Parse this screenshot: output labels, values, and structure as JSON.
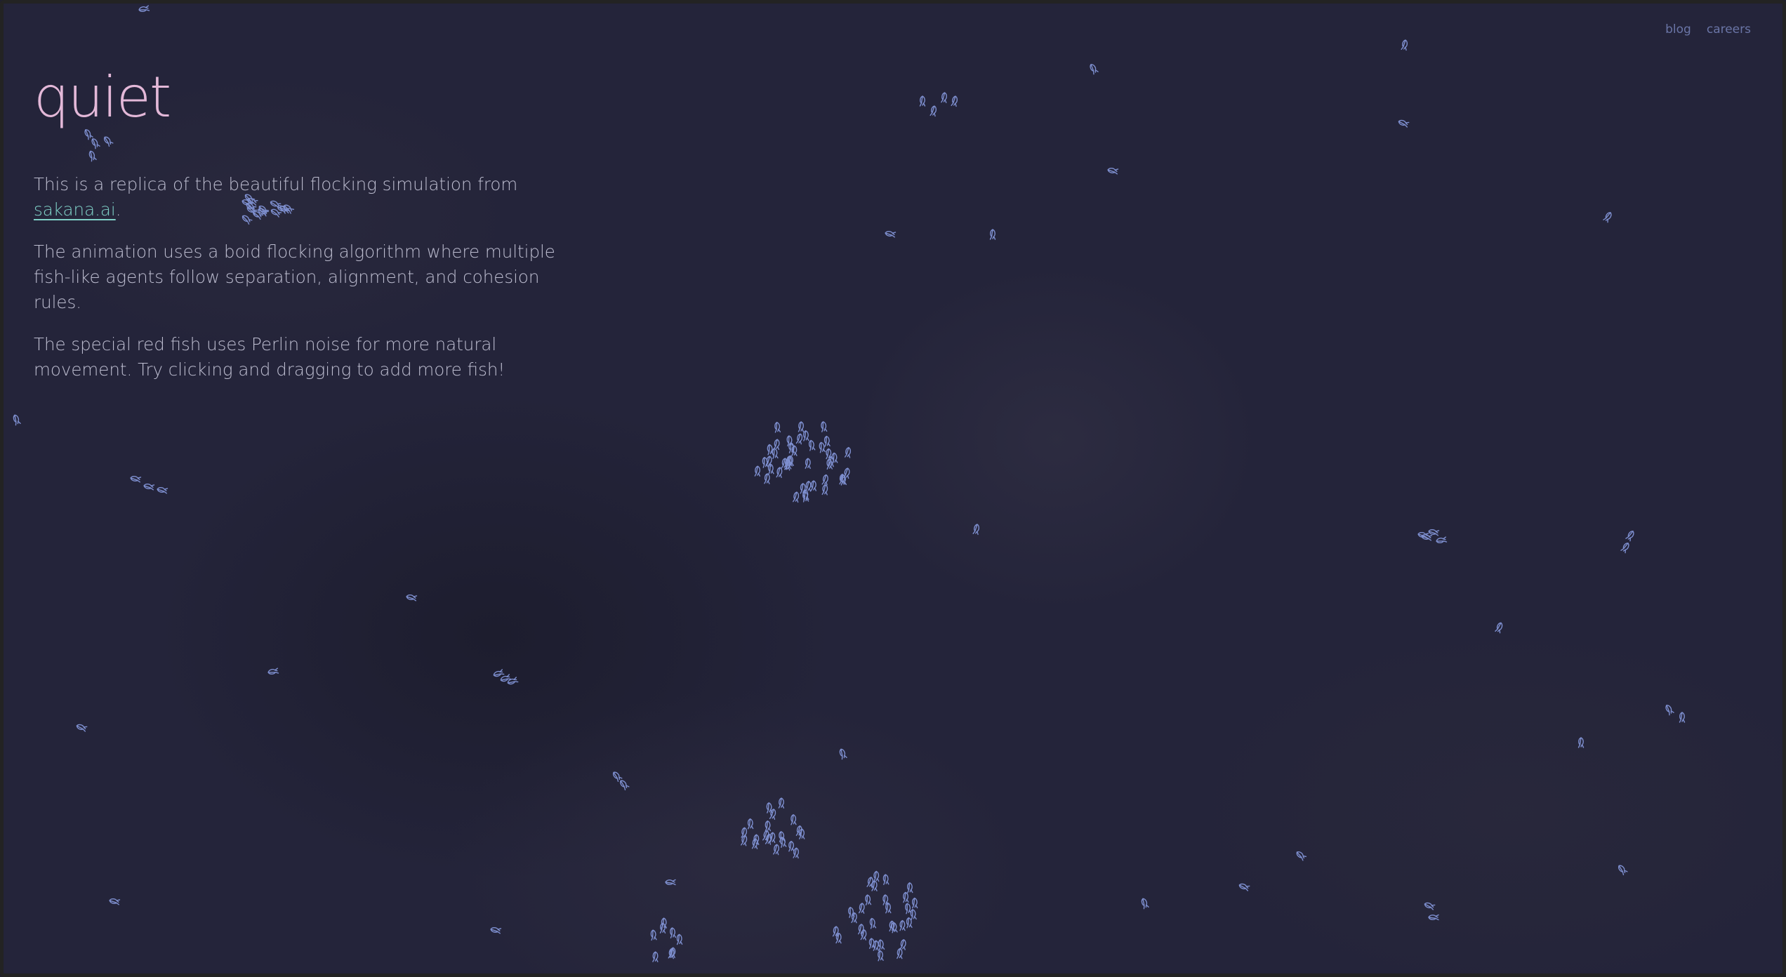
{
  "nav": {
    "blog_label": "blog",
    "careers_label": "careers"
  },
  "title": "quiet",
  "intro": {
    "line1_before_link": "This is a replica of the beautiful flocking simulation from ",
    "link_text": "sakana.ai",
    "line1_after_link": "."
  },
  "paragraph2": "The animation uses a boid flocking algorithm where multiple fish-like agents follow separation, alignment, and cohesion rules.",
  "paragraph3": "The special red fish uses Perlin noise for more natural movement. Try clicking and dragging to add more fish!",
  "colors": {
    "background": "#24243a",
    "title": "#e3b8d8",
    "link": "#7fd0c7",
    "fish_outline": "#7e8fcf",
    "nav_link": "#6a75a6"
  },
  "simulation": {
    "agent_icon": "fish-outline-icon",
    "interaction": "click-and-drag"
  }
}
